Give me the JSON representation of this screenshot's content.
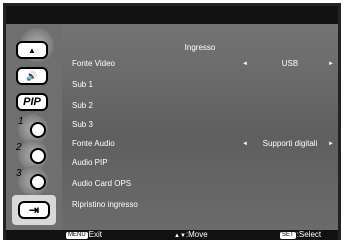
{
  "menu": {
    "title": "Ingresso",
    "rows": [
      {
        "label": "Fonte Video",
        "left_arrow": "◄",
        "value": "USB",
        "right_arrow": "►"
      },
      {
        "label": "Sub 1"
      },
      {
        "label": "Sub 2"
      },
      {
        "label": "Sub 3"
      },
      {
        "label": "Fonte Audio",
        "left_arrow": "◄",
        "value": "Supporti digitali",
        "right_arrow": "►"
      },
      {
        "label": "Audio PIP"
      },
      {
        "label": "Audio Card OPS"
      },
      {
        "label": "Ripristino ingresso"
      }
    ]
  },
  "sidebar": {
    "tabs": [
      {
        "name": "picture",
        "glyph": "▲"
      },
      {
        "name": "audio",
        "glyph": "🔊"
      },
      {
        "name": "pip",
        "glyph": "PIP"
      },
      {
        "name": "tiling",
        "glyph": "1"
      },
      {
        "name": "advanced",
        "glyph": "2"
      },
      {
        "name": "advanced2",
        "glyph": "3"
      },
      {
        "name": "input",
        "glyph": "⇥"
      }
    ]
  },
  "footer": {
    "exit_badge": "MENU",
    "exit": "Exit",
    "move_arrows": "▲▼",
    "move": ":Move",
    "select_badge": "SET",
    "select": ":Select"
  }
}
